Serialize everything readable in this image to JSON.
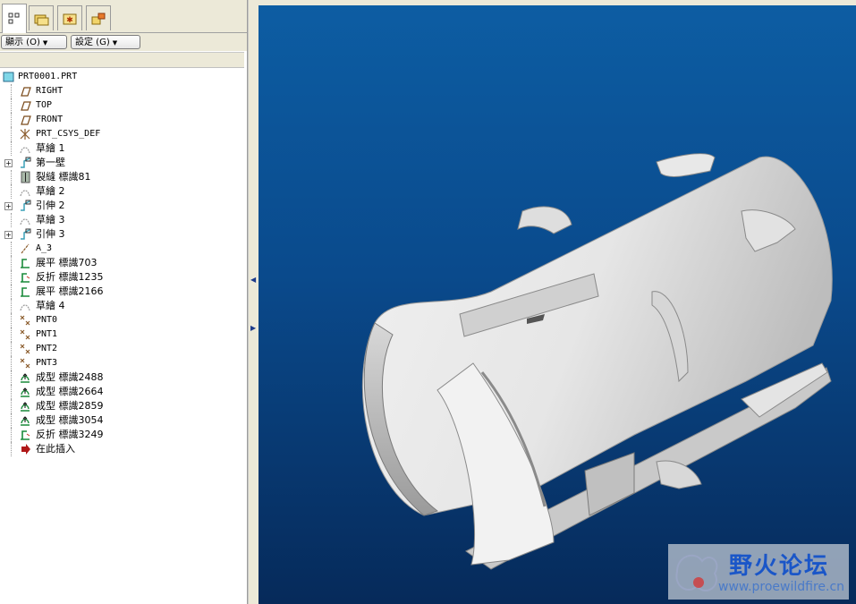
{
  "tabs": [
    {
      "name": "model-tree-tab",
      "icon": "model-tree-icon",
      "active": true
    },
    {
      "name": "folder-browser-tab",
      "icon": "folder-icon",
      "active": false
    },
    {
      "name": "favorites-tab",
      "icon": "favorites-icon",
      "active": false
    },
    {
      "name": "connections-tab",
      "icon": "connections-icon",
      "active": false
    }
  ],
  "toolbar": {
    "show_label": "顯示 (O)",
    "settings_label": "設定 (G)"
  },
  "tree": {
    "root": "PRT0001.PRT",
    "items": [
      {
        "label": "RIGHT",
        "icon": "datum-plane-icon"
      },
      {
        "label": "TOP",
        "icon": "datum-plane-icon"
      },
      {
        "label": "FRONT",
        "icon": "datum-plane-icon"
      },
      {
        "label": "PRT_CSYS_DEF",
        "icon": "csys-icon"
      },
      {
        "label": "草繪 1",
        "icon": "sketch-icon"
      },
      {
        "label": "第一壁",
        "icon": "wall-icon",
        "expandable": true
      },
      {
        "label": "裂縫 標識81",
        "icon": "rip-icon"
      },
      {
        "label": "草繪 2",
        "icon": "sketch-icon"
      },
      {
        "label": "引伸 2",
        "icon": "extrude-icon",
        "expandable": true
      },
      {
        "label": "草繪 3",
        "icon": "sketch-icon"
      },
      {
        "label": "引伸 3",
        "icon": "extrude-icon",
        "expandable": true
      },
      {
        "label": "A_3",
        "icon": "datum-axis-icon"
      },
      {
        "label": "展平 標識703",
        "icon": "unbend-icon"
      },
      {
        "label": "反折 標識1235",
        "icon": "bend-back-icon"
      },
      {
        "label": "展平 標識2166",
        "icon": "unbend-icon"
      },
      {
        "label": "草繪 4",
        "icon": "sketch-icon"
      },
      {
        "label": "PNT0",
        "icon": "datum-point-icon"
      },
      {
        "label": "PNT1",
        "icon": "datum-point-icon"
      },
      {
        "label": "PNT2",
        "icon": "datum-point-icon"
      },
      {
        "label": "PNT3",
        "icon": "datum-point-icon"
      },
      {
        "label": "成型 標識2488",
        "icon": "form-icon"
      },
      {
        "label": "成型 標識2664",
        "icon": "form-icon"
      },
      {
        "label": "成型 標識2859",
        "icon": "form-icon"
      },
      {
        "label": "成型 標識3054",
        "icon": "form-icon"
      },
      {
        "label": "反折 標識3249",
        "icon": "bend-back-icon"
      },
      {
        "label": "在此插入",
        "icon": "insert-here-arrow-icon"
      }
    ]
  },
  "watermark": {
    "title": "野火论坛",
    "url": "www.proewildfire.cn"
  },
  "colors": {
    "viewport_top": "#0d5da3",
    "viewport_bottom": "#062a5a",
    "model": "#e8e8e8",
    "ui_bg": "#ece9d8"
  }
}
